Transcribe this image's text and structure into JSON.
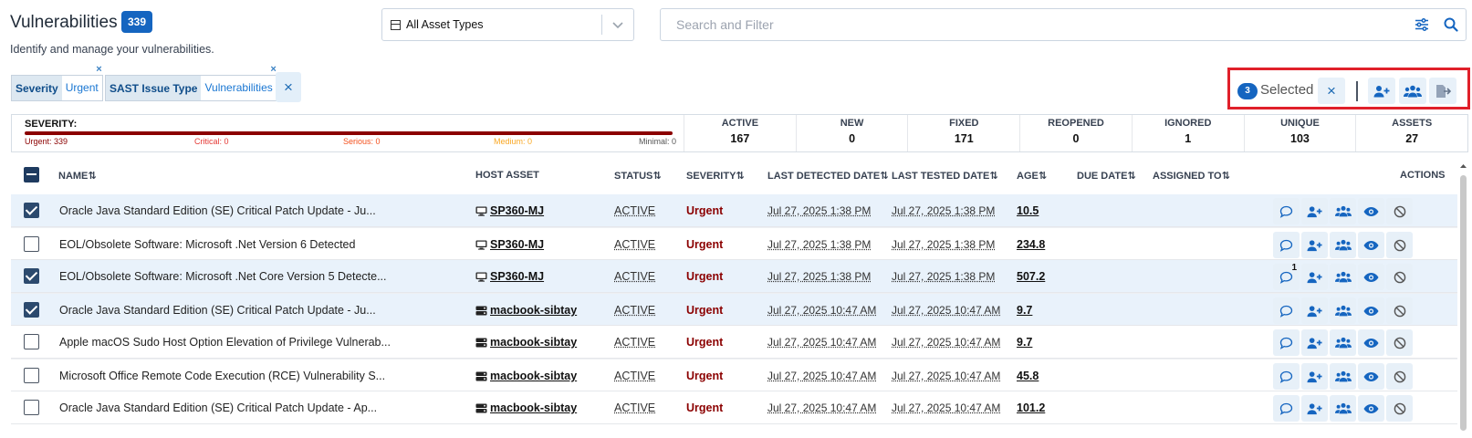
{
  "header": {
    "title": "Vulnerabilities",
    "count": "339",
    "subtitle": "Identify and manage your vulnerabilities."
  },
  "asset_select": {
    "value": "All Asset Types"
  },
  "search": {
    "placeholder": "Search and Filter"
  },
  "filters": [
    {
      "key": "Severity",
      "value": "Urgent",
      "remove": "×"
    },
    {
      "key": "SAST Issue Type",
      "value": "Vulnerabilities",
      "remove": "×"
    }
  ],
  "clear_all": "×",
  "selection": {
    "count": "3",
    "label": "Selected",
    "clear": "×"
  },
  "severity_summary": {
    "title": "SEVERITY:",
    "labels": [
      "Urgent: 339",
      "Critical: 0",
      "Serious: 0",
      "Medium: 0",
      "Minimal: 0"
    ],
    "colors": {
      "urgent": "#8b0000",
      "critical": "#e53935",
      "serious": "#f4511e",
      "medium": "#f9a825",
      "minimal": "#555555"
    }
  },
  "stats": [
    {
      "label": "ACTIVE",
      "value": "167"
    },
    {
      "label": "NEW",
      "value": "0"
    },
    {
      "label": "FIXED",
      "value": "171"
    },
    {
      "label": "REOPENED",
      "value": "0"
    },
    {
      "label": "IGNORED",
      "value": "1"
    },
    {
      "label": "UNIQUE",
      "value": "103"
    },
    {
      "label": "ASSETS",
      "value": "27"
    }
  ],
  "columns": {
    "name": "NAME",
    "host": "HOST ASSET",
    "status": "STATUS",
    "severity": "SEVERITY",
    "last_detected": "LAST DETECTED DATE",
    "last_tested": "LAST TESTED DATE",
    "age": "AGE",
    "due": "DUE DATE",
    "assigned": "ASSIGNED TO",
    "actions": "ACTIONS"
  },
  "rows": [
    {
      "selected": true,
      "name": "Oracle Java Standard Edition (SE) Critical Patch Update - Ju...",
      "host": "SP360-MJ",
      "host_type": "desktop",
      "status": "ACTIVE",
      "severity": "Urgent",
      "last_detected": "Jul 27, 2025 1:38 PM",
      "last_tested": "Jul 27, 2025 1:38 PM",
      "age": "10.5",
      "note": ""
    },
    {
      "selected": false,
      "name": "EOL/Obsolete Software: Microsoft .Net Version 6 Detected",
      "host": "SP360-MJ",
      "host_type": "desktop",
      "status": "ACTIVE",
      "severity": "Urgent",
      "last_detected": "Jul 27, 2025 1:38 PM",
      "last_tested": "Jul 27, 2025 1:38 PM",
      "age": "234.8",
      "note": ""
    },
    {
      "selected": true,
      "name": "EOL/Obsolete Software: Microsoft .Net Core Version 5 Detecte...",
      "host": "SP360-MJ",
      "host_type": "desktop",
      "status": "ACTIVE",
      "severity": "Urgent",
      "last_detected": "Jul 27, 2025 1:38 PM",
      "last_tested": "Jul 27, 2025 1:38 PM",
      "age": "507.2",
      "note": "1"
    },
    {
      "selected": true,
      "name": "Oracle Java Standard Edition (SE) Critical Patch Update - Ju...",
      "host": "macbook-sibtay",
      "host_type": "server",
      "status": "ACTIVE",
      "severity": "Urgent",
      "last_detected": "Jul 27, 2025 10:47 AM",
      "last_tested": "Jul 27, 2025 10:47 AM",
      "age": "9.7",
      "note": ""
    },
    {
      "selected": false,
      "name": "Apple macOS Sudo Host Option Elevation of Privilege Vulnerab...",
      "host": "macbook-sibtay",
      "host_type": "server",
      "status": "ACTIVE",
      "severity": "Urgent",
      "last_detected": "Jul 27, 2025 10:47 AM",
      "last_tested": "Jul 27, 2025 10:47 AM",
      "age": "9.7",
      "note": ""
    },
    {
      "selected": false,
      "name": "Microsoft Office Remote Code Execution (RCE) Vulnerability S...",
      "host": "macbook-sibtay",
      "host_type": "server",
      "status": "ACTIVE",
      "severity": "Urgent",
      "last_detected": "Jul 27, 2025 10:47 AM",
      "last_tested": "Jul 27, 2025 10:47 AM",
      "age": "45.8",
      "note": ""
    },
    {
      "selected": false,
      "name": "Oracle Java Standard Edition (SE) Critical Patch Update - Ap...",
      "host": "macbook-sibtay",
      "host_type": "server",
      "status": "ACTIVE",
      "severity": "Urgent",
      "last_detected": "Jul 27, 2025 10:47 AM",
      "last_tested": "Jul 27, 2025 10:47 AM",
      "age": "101.2",
      "note": ""
    }
  ],
  "row_actions": [
    "comment-icon",
    "assign-user-icon",
    "assign-group-icon",
    "view-icon",
    "ignore-icon"
  ],
  "colors": {
    "accent": "#1565c0",
    "urgent": "#8b0000",
    "selected_row": "#e9f2fb",
    "highlight_box": "#e0202a"
  }
}
